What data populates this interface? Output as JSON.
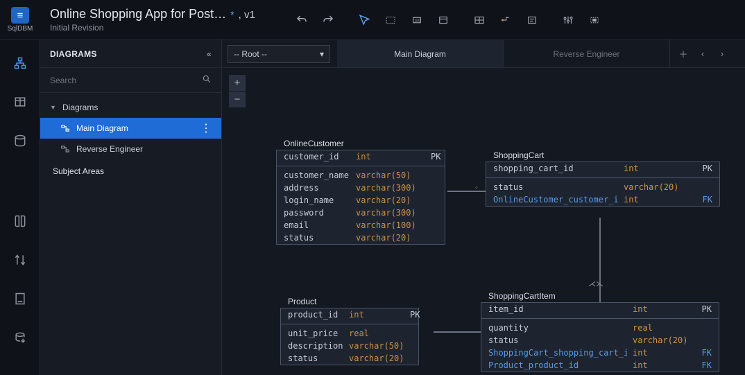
{
  "header": {
    "logo_letter": "≡",
    "logo_text": "SqlDBM",
    "title": "Online Shopping App for Post…",
    "star": "*",
    "version": ", v1",
    "subtitle": "Initial Revision"
  },
  "side": {
    "panel_title": "DIAGRAMS",
    "search_placeholder": "Search",
    "group_diagrams": "Diagrams",
    "item_main": "Main Diagram",
    "item_reverse": "Reverse Engineer",
    "group_subject": "Subject Areas"
  },
  "tabs": {
    "dropdown": "-- Root --",
    "main": "Main Diagram",
    "reverse": "Reverse Engineer"
  },
  "entities": {
    "customer": {
      "title": "OnlineCustomer",
      "rows": [
        {
          "n": "customer_id",
          "t": "int",
          "k": "PK",
          "pk": true
        },
        {
          "n": "customer_name",
          "t": "varchar(50)"
        },
        {
          "n": "address",
          "t": "varchar(300)"
        },
        {
          "n": "login_name",
          "t": "varchar(20)"
        },
        {
          "n": "password",
          "t": "varchar(300)"
        },
        {
          "n": "email",
          "t": "varchar(100)"
        },
        {
          "n": "status",
          "t": "varchar(20)"
        }
      ]
    },
    "cart": {
      "title": "ShoppingCart",
      "rows": [
        {
          "n": "shopping_cart_id",
          "t": "int",
          "k": "PK",
          "pk": true
        },
        {
          "n": "status",
          "t": "varchar(20)"
        },
        {
          "n": "OnlineCustomer_customer_id",
          "t": "int",
          "k": "FK",
          "fk": true
        }
      ]
    },
    "product": {
      "title": "Product",
      "rows": [
        {
          "n": "product_id",
          "t": "int",
          "k": "PK",
          "pk": true
        },
        {
          "n": "unit_price",
          "t": "real"
        },
        {
          "n": "description",
          "t": "varchar(50)"
        },
        {
          "n": "status",
          "t": "varchar(20)"
        }
      ]
    },
    "item": {
      "title": "ShoppingCartItem",
      "rows": [
        {
          "n": "item_id",
          "t": "int",
          "k": "PK",
          "pk": true
        },
        {
          "n": "quantity",
          "t": "real"
        },
        {
          "n": "status",
          "t": "varchar(20)"
        },
        {
          "n": "ShoppingCart_shopping_cart_id",
          "t": "int",
          "k": "FK",
          "fk": true
        },
        {
          "n": "Product_product_id",
          "t": "int",
          "k": "FK",
          "fk": true
        }
      ]
    }
  }
}
